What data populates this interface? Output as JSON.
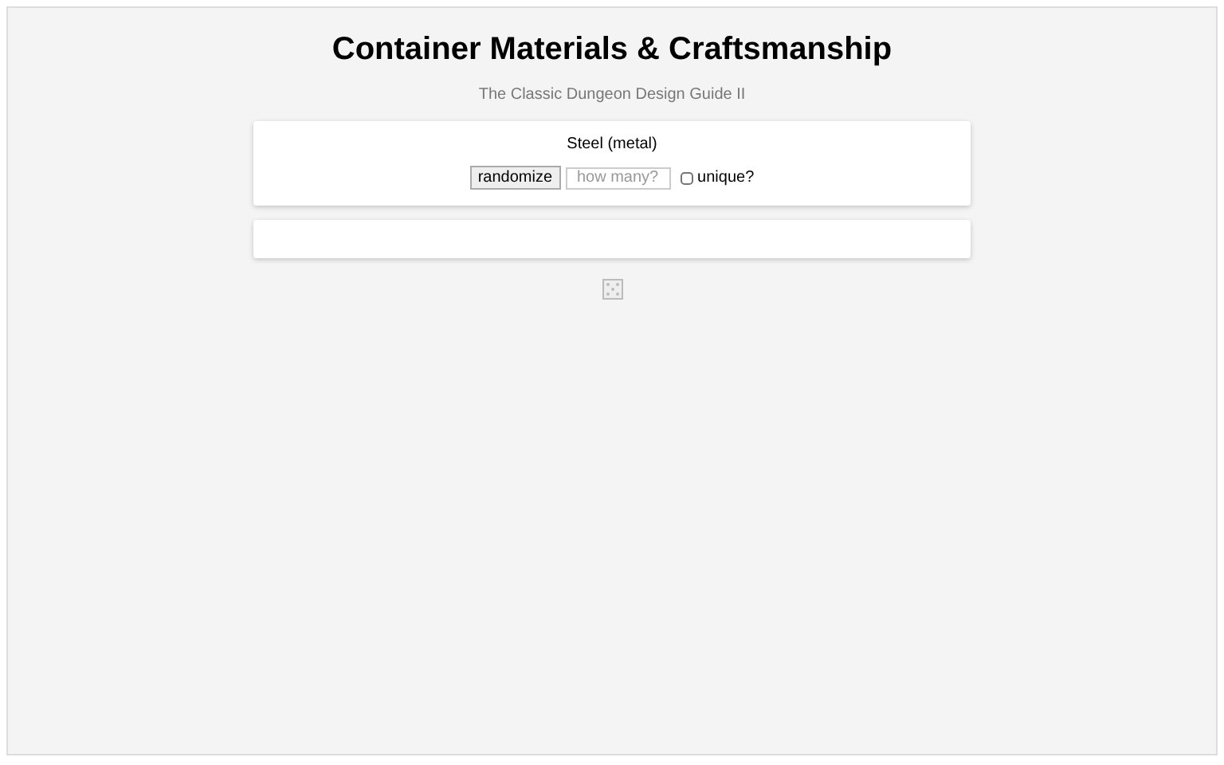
{
  "title": "Container Materials & Craftsmanship",
  "subtitle": "The Classic Dungeon Design Guide II",
  "result": "Steel (metal)",
  "controls": {
    "button": "randomize",
    "count": {
      "placeholder": "how many?"
    },
    "unique": {
      "label": "unique?",
      "checked": false
    }
  }
}
